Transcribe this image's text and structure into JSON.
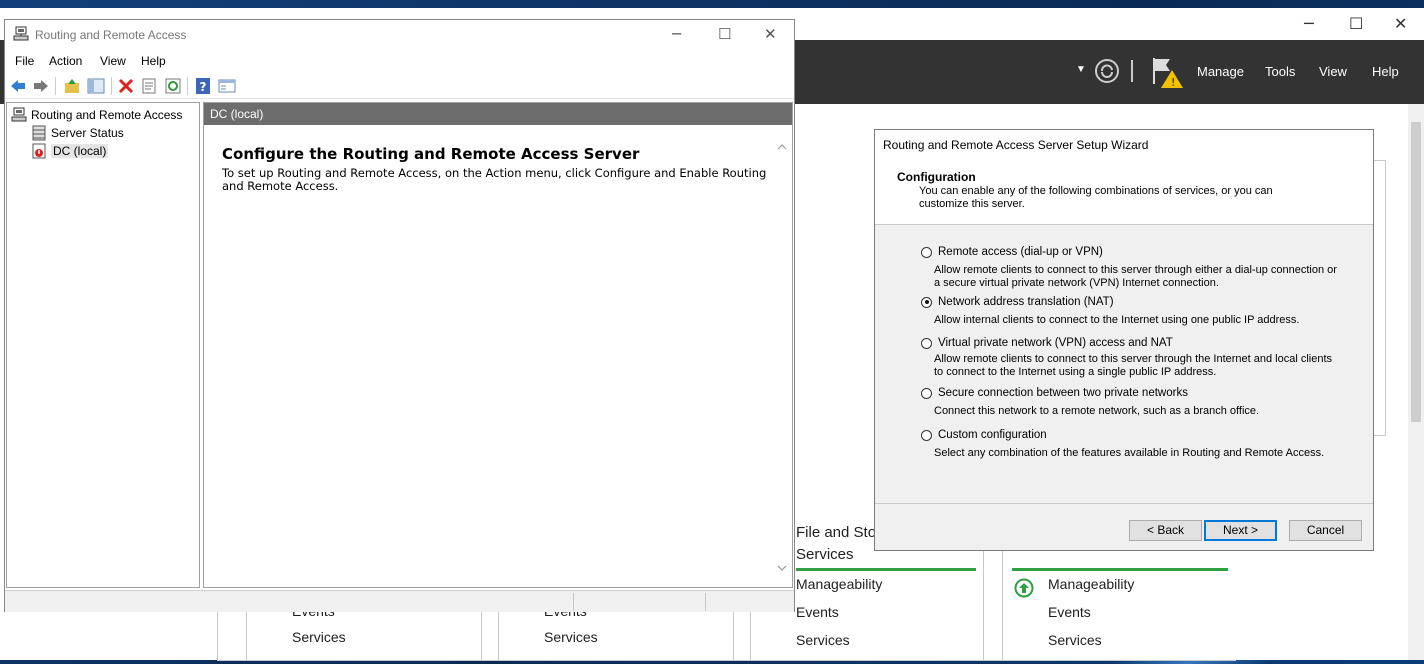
{
  "server_manager": {
    "menu": [
      "Manage",
      "Tools",
      "View",
      "Help"
    ],
    "tiles": {
      "col1": [
        "Events",
        "Services"
      ],
      "col2": [
        "Events",
        "Services"
      ],
      "col3": {
        "title_line1": "File and Sto",
        "title_line2": "Services",
        "items": [
          "Manageability",
          "Events",
          "Services"
        ]
      },
      "col4": {
        "items": [
          "Manageability",
          "Events",
          "Services"
        ]
      }
    }
  },
  "mmc": {
    "title": "Routing and Remote Access",
    "menu": [
      "File",
      "Action",
      "View",
      "Help"
    ],
    "tree": {
      "root": "Routing and Remote Access",
      "children": [
        "Server Status",
        "DC (local)"
      ]
    },
    "main": {
      "header": "DC (local)",
      "heading": "Configure the Routing and Remote Access Server",
      "body": "To set up Routing and Remote Access, on the Action menu, click Configure and Enable Routing and Remote Access."
    }
  },
  "wizard": {
    "title": "Routing and Remote Access Server Setup Wizard",
    "section_title": "Configuration",
    "section_sub": "You can enable any of the following combinations of services, or you can customize this server.",
    "options": [
      {
        "label": "Remote access (dial-up or VPN)",
        "desc": "Allow remote clients to connect to this server through either a dial-up connection or a secure virtual private network (VPN) Internet connection.",
        "selected": false
      },
      {
        "label": "Network address translation (NAT)",
        "desc": "Allow internal clients to connect to the Internet using one public IP address.",
        "selected": true
      },
      {
        "label": "Virtual private network (VPN) access and NAT",
        "desc": "Allow remote clients to connect to this server through the Internet and local clients to connect to the Internet using a single public IP address.",
        "selected": false
      },
      {
        "label": "Secure connection between two private networks",
        "desc": "Connect this network to a remote network, such as a branch office.",
        "selected": false
      },
      {
        "label": "Custom configuration",
        "desc": "Select any combination of the features available in Routing and Remote Access.",
        "selected": false
      }
    ],
    "buttons": {
      "back": "< Back",
      "next": "Next >",
      "cancel": "Cancel"
    }
  },
  "colors": {
    "sm_header": "#333333",
    "accent_green": "#2ea042",
    "selection_blue": "#0078d7"
  }
}
